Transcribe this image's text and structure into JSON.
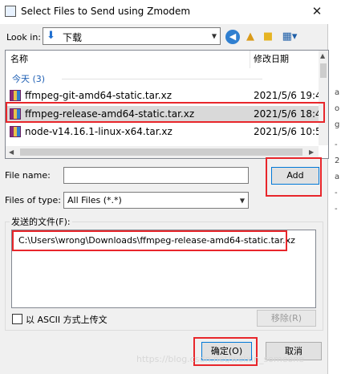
{
  "window": {
    "title": "Select Files to Send using Zmodem",
    "close_glyph": "✕"
  },
  "look_in": {
    "label": "Look in:",
    "folder": "下载"
  },
  "file_list": {
    "columns": [
      "名称",
      "修改日期"
    ],
    "group_label": "今天 (3)",
    "rows": [
      {
        "name": "ffmpeg-git-amd64-static.tar.xz",
        "date": "2021/5/6 19:4",
        "selected": false
      },
      {
        "name": "ffmpeg-release-amd64-static.tar.xz",
        "date": "2021/5/6 18:4",
        "selected": true
      },
      {
        "name": "node-v14.16.1-linux-x64.tar.xz",
        "date": "2021/5/6 10:5",
        "selected": false
      }
    ]
  },
  "file_name": {
    "label": "File name:",
    "value": ""
  },
  "file_type": {
    "label": "Files of type:",
    "value": "All Files (*.*)"
  },
  "buttons": {
    "add": "Add",
    "remove": "移除(R)",
    "ok": "确定(O)",
    "cancel": "取消"
  },
  "send_box": {
    "title": "发送的文件(F):",
    "files": [
      "C:\\Users\\wrong\\Downloads\\ffmpeg-release-amd64-static.tar.xz"
    ]
  },
  "ascii_option": {
    "label": "以 ASCII 方式上传文",
    "checked": false
  },
  "watermark": "https://blog.csdn.net/weixin_someone",
  "behind_strip": [
    "a",
    "o",
    "g",
    "-",
    "2",
    "a",
    "-",
    "-"
  ],
  "colors": {
    "highlight": "#e8262b",
    "group_blue": "#1e5fb4",
    "selection": "#d9d9d9"
  }
}
